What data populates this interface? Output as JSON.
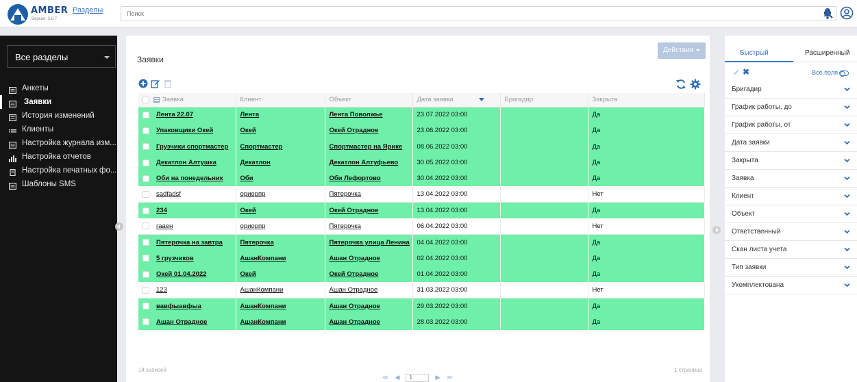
{
  "header": {
    "logo_name": "AMBER",
    "sections_link": "Разделы",
    "version": "Версия: 3.8.7",
    "search_placeholder": "Поиск"
  },
  "sidebar": {
    "select_label": "Все разделы",
    "items": [
      {
        "label": "Анкеты",
        "icon": "form-icon",
        "active": false
      },
      {
        "label": "Заявки",
        "icon": "form-icon",
        "active": true
      },
      {
        "label": "История изменений",
        "icon": "form-icon",
        "active": false
      },
      {
        "label": "Клиенты",
        "icon": "list-icon",
        "active": false
      },
      {
        "label": "Настройка журнала изм...",
        "icon": "form-icon",
        "active": false
      },
      {
        "label": "Настройка отчетов",
        "icon": "bar-chart-icon",
        "active": false
      },
      {
        "label": "Настройка печатных фо...",
        "icon": "document-icon",
        "active": false
      },
      {
        "label": "Шаблоны SMS",
        "icon": "form-icon",
        "active": false
      }
    ]
  },
  "main": {
    "title": "Заявки",
    "actions_label": "Действия",
    "columns": [
      "Заявка",
      "Клиент",
      "Объект",
      "Дата заявки",
      "Бригадир",
      "Закрыта"
    ],
    "rows": [
      {
        "request": "Лента 22.07",
        "client": "Лента",
        "object": "Лента Поволжье",
        "date": "23.07.2022 03:00",
        "foreman": "",
        "closed": "Да"
      },
      {
        "request": "Упаковщики Окей",
        "client": "Окей",
        "object": "Окей Отрадное",
        "date": "23.06.2022 03:00",
        "foreman": "",
        "closed": "Да"
      },
      {
        "request": "Грузчики спортмастер",
        "client": "Спортмастер",
        "object": "Спортмастер на Ярике",
        "date": "08.06.2022 03:00",
        "foreman": "",
        "closed": "Да"
      },
      {
        "request": "Декатлон Алтушка",
        "client": "Декатлон",
        "object": "Декатлон Алтуфьево",
        "date": "30.05.2022 03:00",
        "foreman": "",
        "closed": "Да"
      },
      {
        "request": "Оби на понедельник",
        "client": "Оби",
        "object": "Оби Лефортово",
        "date": "30.04.2022 03:00",
        "foreman": "",
        "closed": "Да"
      },
      {
        "request": "sadfadsf",
        "client": "ориорпр",
        "object": "Пятерочка",
        "date": "13.04.2022 03:00",
        "foreman": "",
        "closed": "Нет"
      },
      {
        "request": "234",
        "client": "Окей",
        "object": "Окей Отрадное",
        "date": "13.04.2022 03:00",
        "foreman": "",
        "closed": "Да"
      },
      {
        "request": "гааен",
        "client": "ориорпр",
        "object": "Пятерочка",
        "date": "06.04.2022 03:00",
        "foreman": "",
        "closed": "Нет"
      },
      {
        "request": "Пятерочка на завтра",
        "client": "Пятерочка",
        "object": "Пятерочка улица Ленина",
        "date": "04.04.2022 03:00",
        "foreman": "",
        "closed": "Да"
      },
      {
        "request": "5 грузчиков",
        "client": "АшанКомпани",
        "object": "Ашан Отрадное",
        "date": "02.04.2022 03:00",
        "foreman": "",
        "closed": "Да"
      },
      {
        "request": "Окей 01.04.2022",
        "client": "Окей",
        "object": "Окей Отрадное",
        "date": "01.04.2022 03:00",
        "foreman": "",
        "closed": "Да"
      },
      {
        "request": "123",
        "client": "АшанКомпани",
        "object": "Ашан Отрадное",
        "date": "31.03.2022 03:00",
        "foreman": "",
        "closed": "Нет"
      },
      {
        "request": "вавфыавфыа",
        "client": "АшанКомпани",
        "object": "Ашан Отрадное",
        "date": "29.03.2022 03:00",
        "foreman": "",
        "closed": "Да"
      },
      {
        "request": "Ашан Отрадное",
        "client": "АшанКомпани",
        "object": "Ашан Отрадное",
        "date": "28.03.2022 03:00",
        "foreman": "",
        "closed": "Да"
      }
    ],
    "record_count": "14 записей",
    "page_count": "1 страница",
    "pager": {
      "first": "≪",
      "prev": "◀",
      "current": "1",
      "next": "▶",
      "last": "≫"
    },
    "colors": {
      "closed_row": "#6ef0a8",
      "accent": "#3a76c4",
      "sidebar_bg": "#141414"
    }
  },
  "filters": {
    "tab_quick": "Быстрый",
    "tab_extended": "Расширенный",
    "all_fields": "Все поля",
    "items": [
      "Бригадир",
      "График работы, до",
      "График работы, от",
      "Дата заявки",
      "Закрыта",
      "Заявка",
      "Клиент",
      "Объект",
      "Ответственный",
      "Скан листа учета",
      "Тип заявки",
      "Укомплектована"
    ]
  }
}
